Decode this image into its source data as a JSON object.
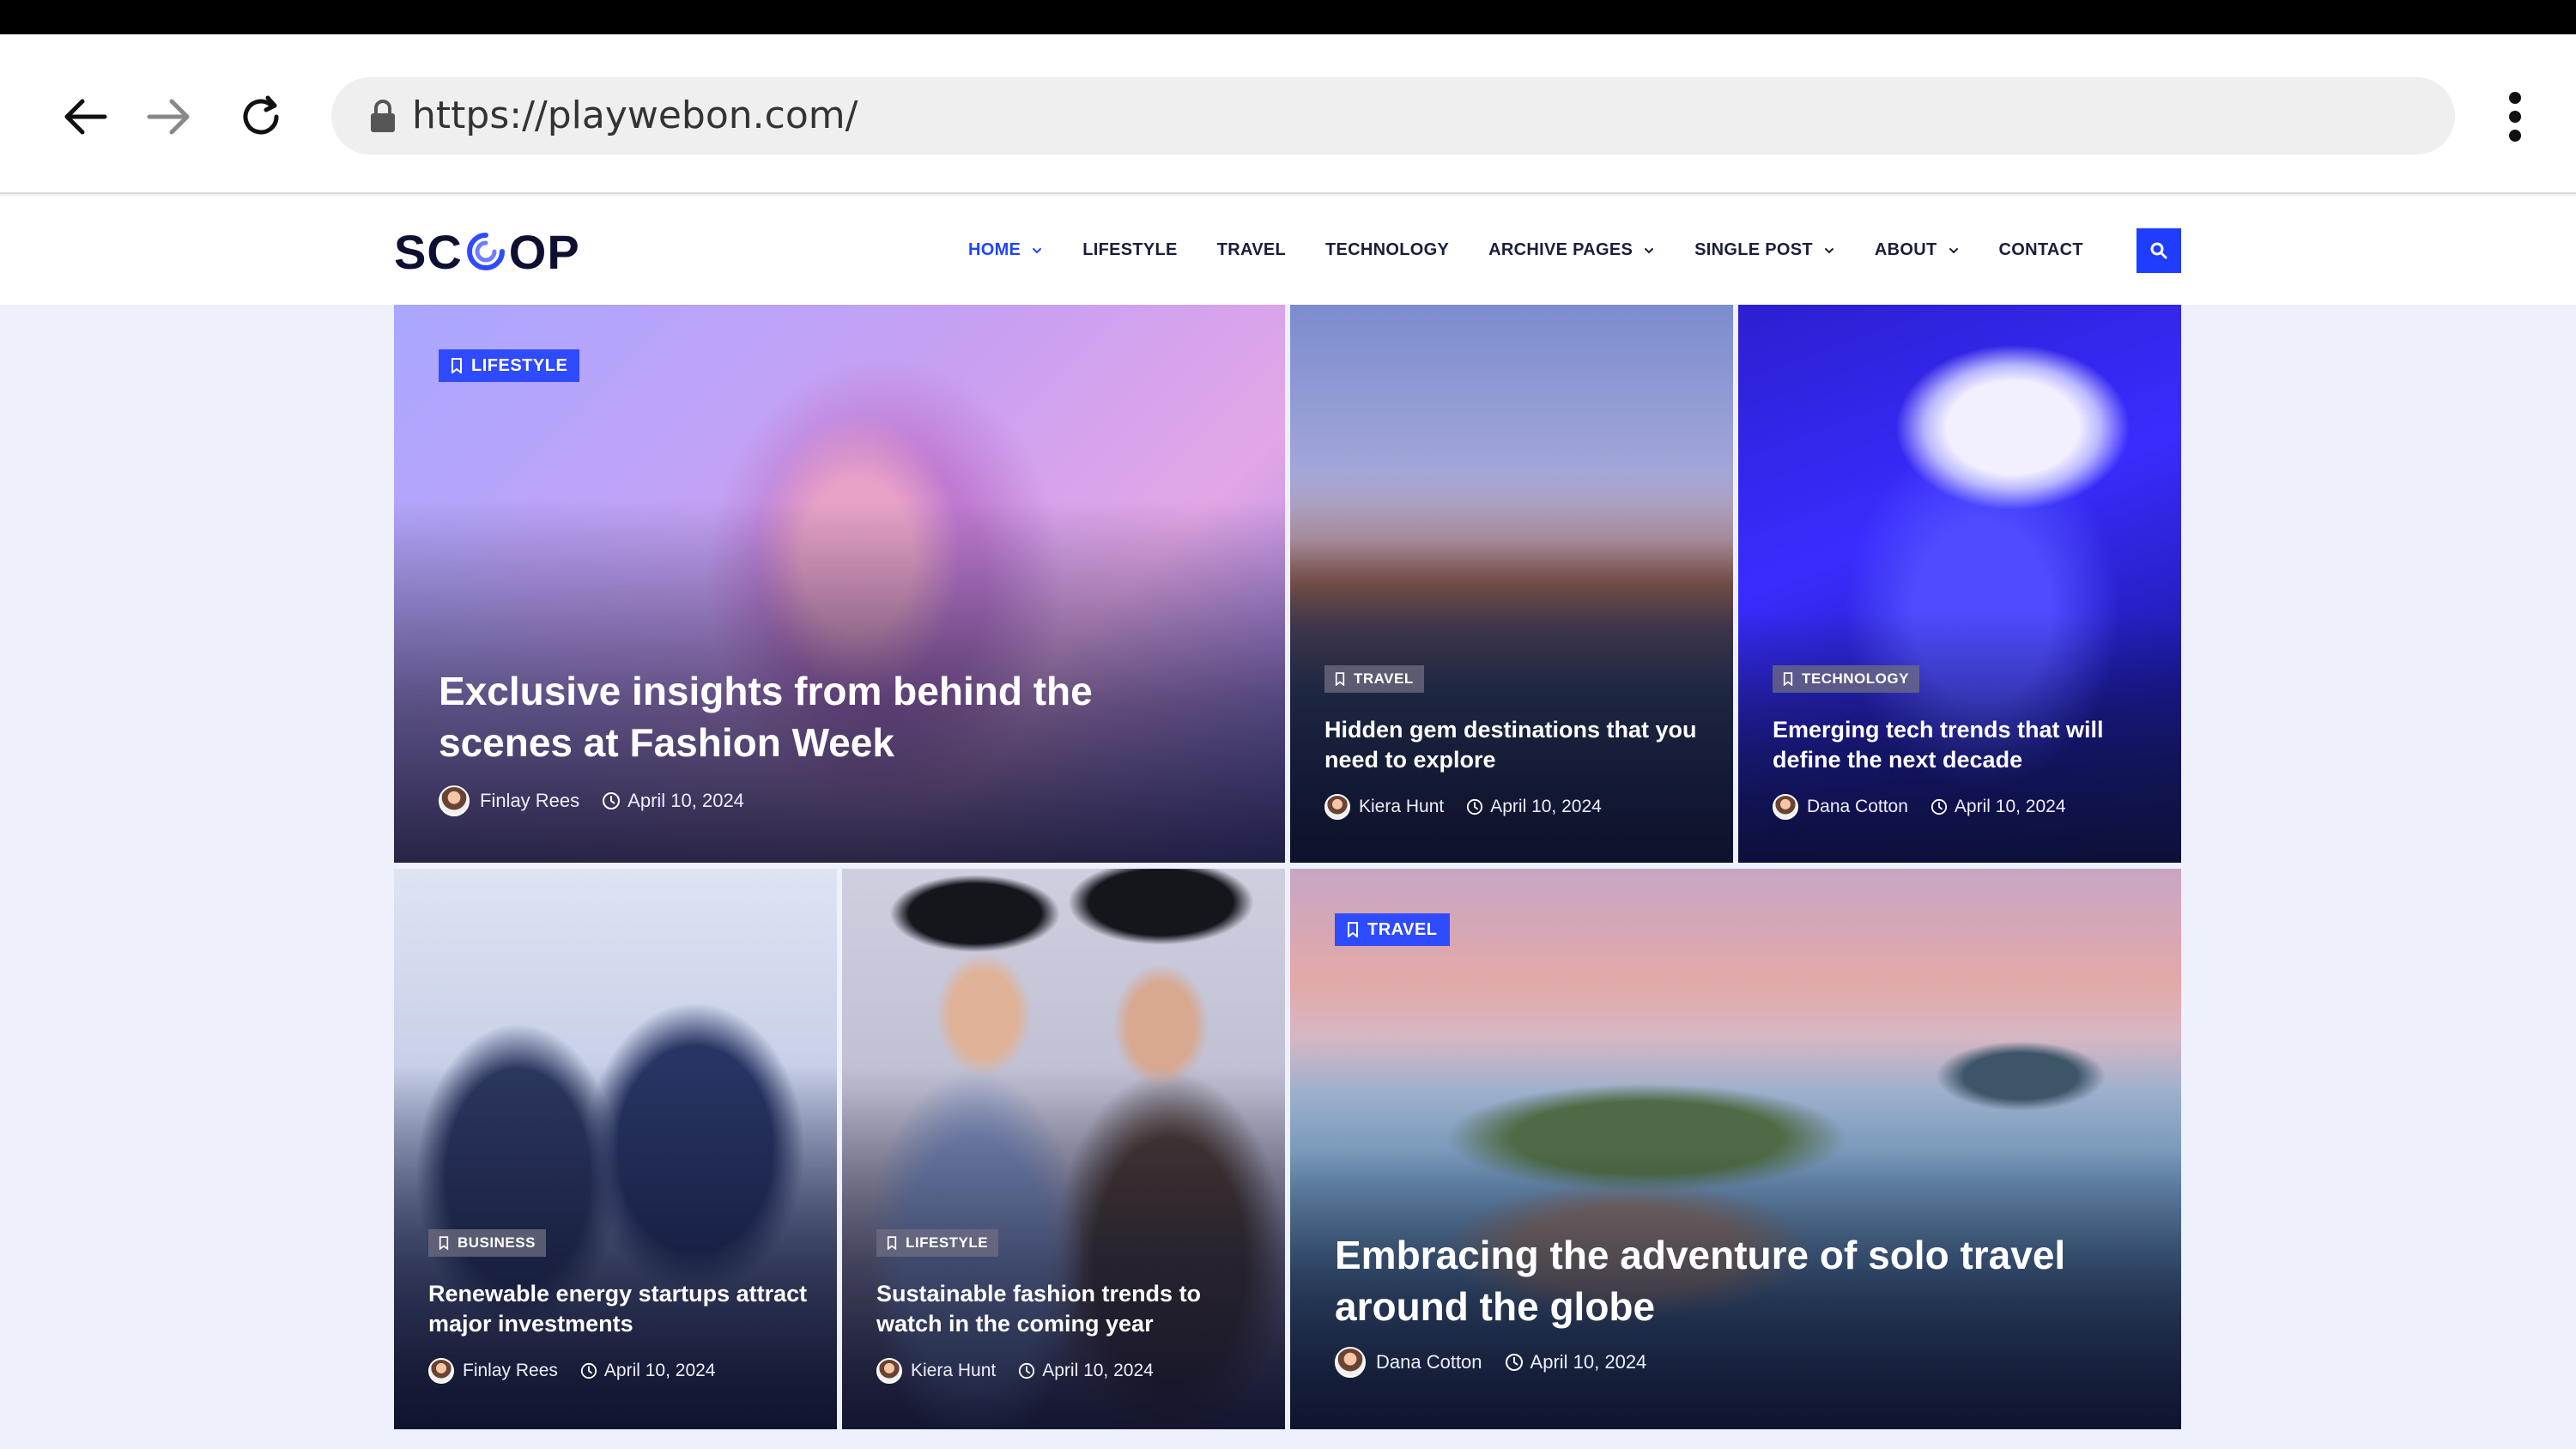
{
  "browser": {
    "url": "https://playwebon.com/",
    "icons": [
      "back-arrow-icon",
      "forward-arrow-icon",
      "reload-icon",
      "lock-icon",
      "kebab-menu-icon"
    ]
  },
  "site": {
    "logo_left": "SC",
    "logo_right": "OP",
    "menu": [
      {
        "label": "HOME",
        "active": true,
        "dropdown": true
      },
      {
        "label": "LIFESTYLE",
        "active": false,
        "dropdown": false
      },
      {
        "label": "TRAVEL",
        "active": false,
        "dropdown": false
      },
      {
        "label": "TECHNOLOGY",
        "active": false,
        "dropdown": false
      },
      {
        "label": "ARCHIVE PAGES",
        "active": false,
        "dropdown": true
      },
      {
        "label": "SINGLE POST",
        "active": false,
        "dropdown": true
      },
      {
        "label": "ABOUT",
        "active": false,
        "dropdown": true
      },
      {
        "label": "CONTACT",
        "active": false,
        "dropdown": false
      }
    ],
    "accent": "#1f3cff"
  },
  "posts": [
    {
      "category": "LIFESTYLE",
      "title_1": "Exclusive insights from behind the",
      "title_2": "scenes at Fashion Week",
      "author": "Finlay Rees",
      "date": "April 10, 2024"
    },
    {
      "category": "TRAVEL",
      "title_1": "Hidden gem destinations that you",
      "title_2": "need to explore",
      "author": "Kiera Hunt",
      "date": "April 10, 2024"
    },
    {
      "category": "TECHNOLOGY",
      "title_1": "Emerging tech trends that will",
      "title_2": "define the next decade",
      "author": "Dana Cotton",
      "date": "April 10, 2024"
    },
    {
      "category": "BUSINESS",
      "title_1": "Renewable energy startups attract",
      "title_2": "major investments",
      "author": "Finlay Rees",
      "date": "April 10, 2024"
    },
    {
      "category": "LIFESTYLE",
      "title_1": "Sustainable fashion trends to",
      "title_2": "watch in the coming year",
      "author": "Kiera Hunt",
      "date": "April 10, 2024"
    },
    {
      "category": "TRAVEL",
      "title_1": "Embracing the adventure of solo travel",
      "title_2": "around the globe",
      "author": "Dana Cotton",
      "date": "April 10, 2024"
    }
  ]
}
